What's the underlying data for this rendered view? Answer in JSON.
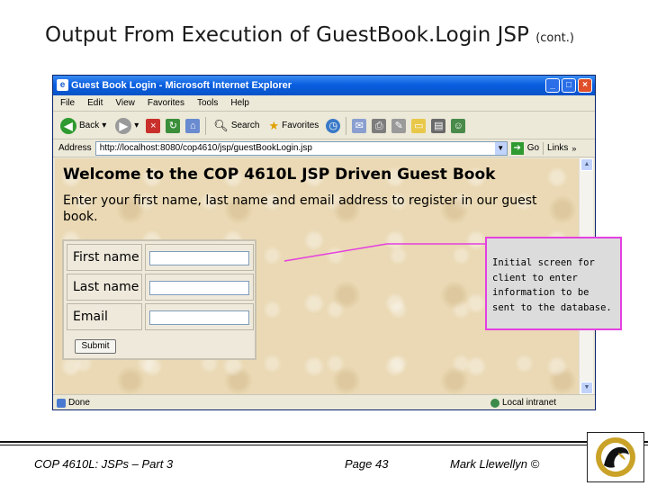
{
  "slide": {
    "title": "Output From Execution of GuestBook.Login JSP",
    "title_suffix": "(cont.)"
  },
  "browser": {
    "window_title": "Guest Book Login - Microsoft Internet Explorer",
    "menu": [
      "File",
      "Edit",
      "View",
      "Favorites",
      "Tools",
      "Help"
    ],
    "toolbar": {
      "back": "Back",
      "search": "Search",
      "favorites": "Favorites"
    },
    "address_label": "Address",
    "address_url": "http://localhost:8080/cop4610/jsp/guestBookLogin.jsp",
    "go_label": "Go",
    "links_label": "Links",
    "status_left": "Done",
    "status_right": "Local intranet"
  },
  "page": {
    "heading": "Welcome to the COP 4610L JSP Driven Guest Book",
    "intro": "Enter your first name, last name and email address to register in our guest book.",
    "form": {
      "fields": [
        {
          "label": "First name",
          "value": ""
        },
        {
          "label": "Last name",
          "value": ""
        },
        {
          "label": "Email",
          "value": ""
        }
      ],
      "submit_label": "Submit"
    }
  },
  "callout": {
    "text": "Initial screen for client to enter information to be sent to the database."
  },
  "footer": {
    "course": "COP 4610L: JSPs – Part 3",
    "page": "Page 43",
    "author": "Mark Llewellyn ©"
  },
  "colors": {
    "callout_border": "#e43fe0",
    "pointer_line": "#e43fe0",
    "page_background": "#ead9b4"
  }
}
